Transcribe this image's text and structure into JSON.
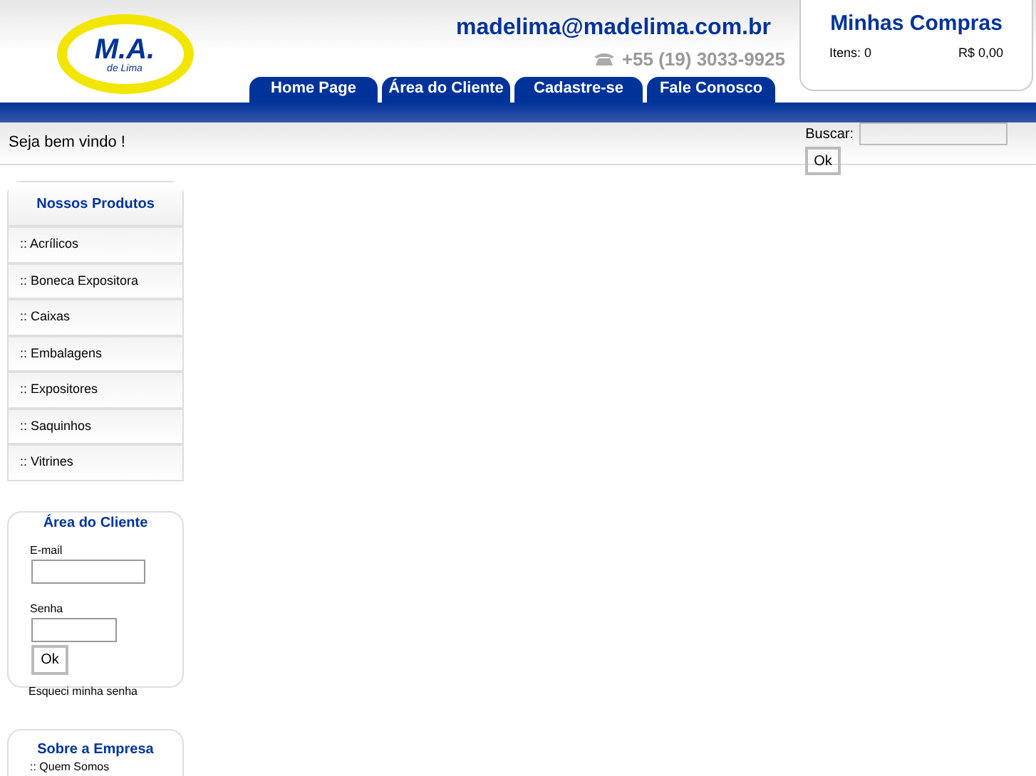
{
  "header": {
    "logo_text": "M.A.",
    "logo_subtext": "de Lima",
    "email": "madelima@madelima.com.br",
    "phone": "+55 (19) 3033-9925"
  },
  "cart": {
    "title": "Minhas Compras",
    "items": "Itens: 0",
    "total": "R$ 0,00"
  },
  "nav_tabs": [
    {
      "label": "Home Page"
    },
    {
      "label": "Área do Cliente"
    },
    {
      "label": "Cadastre-se"
    },
    {
      "label": "Fale Conosco"
    }
  ],
  "welcome": "Seja bem vindo !",
  "search": {
    "label": "Buscar:",
    "button": "Ok"
  },
  "products": {
    "title": "Nossos Produtos",
    "items": [
      ":: Acrílicos",
      ":: Boneca Expositora",
      ":: Caixas",
      ":: Embalagens",
      ":: Expositores",
      ":: Saquinhos",
      ":: Vitrines"
    ]
  },
  "client_area": {
    "title": "Área do Cliente",
    "email_label": "E-mail",
    "password_label": "Senha",
    "button": "Ok",
    "forgot": "Esqueci minha senha"
  },
  "about": {
    "title": "Sobre a Empresa",
    "items": [
      ":: Quem Somos"
    ]
  }
}
